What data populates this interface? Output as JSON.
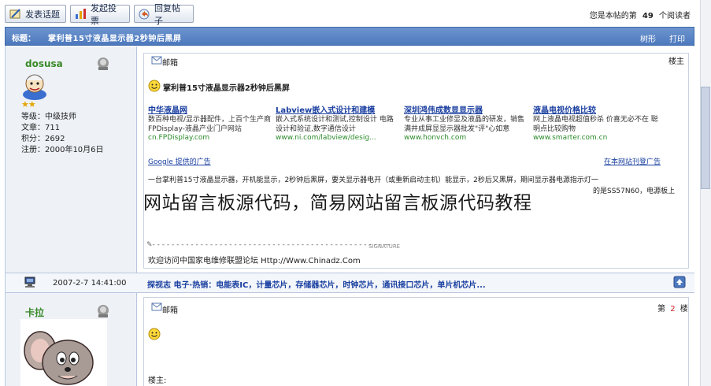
{
  "toolbar": {
    "post_topic": "发表话题",
    "post_poll": "发起投票",
    "reply": "回复帖子",
    "visitor_prefix": "您是本帖的第",
    "visitor_count": "49",
    "visitor_suffix": "个阅读者"
  },
  "thread": {
    "title_label": "标题：",
    "title": "掌利普15寸液晶显示器2秒钟后黑屏",
    "link_tree": "树形",
    "link_print": "打印"
  },
  "post1": {
    "username": "dosusa",
    "info": [
      "等级：中级技师",
      "文章：711",
      "积分：2692",
      "注册：2000年10月6日"
    ],
    "mailbox": "邮箱",
    "floor": "楼主",
    "subject": "掌利普15寸液晶显示器2秒钟后黑屏",
    "ads": [
      {
        "title": "中华液晶网",
        "desc": "数百种电视/显示器配件，上百个生产商FPDisplay-液晶产业门户网站",
        "url": "cn.FPDisplay.com"
      },
      {
        "title": "Labview嵌入式设计和建模",
        "desc": "嵌入式系统设计和测试,控制设计 电路设计和验证,数字通信设计",
        "url": "www.ni.com/labview/desig..."
      },
      {
        "title": "深圳鸿伟成数显显示器",
        "desc": "专业从事工业修显及液晶的研发，销售 满井成屏显显示器批发\"评\"心如意",
        "url": "www.honvch.com"
      },
      {
        "title": "液晶电视价格比较",
        "desc": "网上液晶电视超值秒杀 价喜无必不在 聪明点比较购物",
        "url": "www.smarter.com.cn"
      }
    ],
    "google_ads": "Google 提供的广告",
    "ad_here": "在本网站刊登广告",
    "body_line1": "一台掌利普15寸液晶显示器，开机能显示，2秒钟后黑屏，要关显示器电开（或重新启动主机）能显示，2秒后又黑屏，期间显示器电源指示灯一",
    "body_line2_end": "的是SS57N60，电源板上",
    "watermark": "网站留言板源代码，简易网站留言板源代码教程",
    "sig_mark": "SIGNATURE",
    "signature": "欢迎访问中国家电维修联盟论坛 Http://Www.Chinadz.Com",
    "post_time": "2007-2-7 14:41:00",
    "footer_links": "探视志 电子·热销：电能表IC，计量芯片，存储器芯片，时钟芯片，通讯接口芯片，单片机芯片..."
  },
  "post2": {
    "username": "卡拉",
    "mailbox": "邮箱",
    "floor_prefix": "第",
    "floor_num": "2",
    "floor_suffix": "楼",
    "reply_to": "楼主:"
  },
  "colors": {
    "title_bar": "#4d79bd",
    "username_green": "#3a8a2a",
    "link_blue": "#1a3fa0",
    "floor_red": "#d02020"
  }
}
